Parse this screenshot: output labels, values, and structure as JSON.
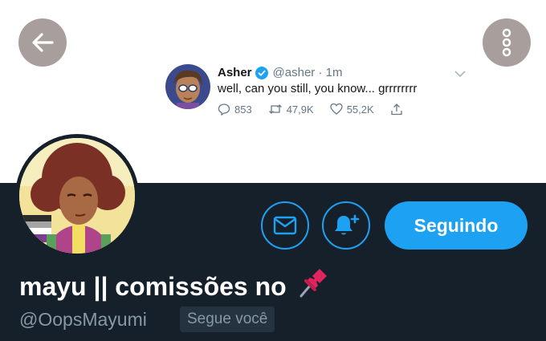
{
  "tweet": {
    "name": "Asher",
    "handle_time": "@asher · 1m",
    "text": "well, can you still, you know... grrrrrrrr",
    "replies": "853",
    "retweets": "47,9K",
    "likes": "55,2K"
  },
  "profile": {
    "display_name": "mayu || comissões no",
    "handle": "@OopsMayumi",
    "follows_you": "Segue você",
    "follow_button": "Seguindo"
  },
  "icons": {
    "back": "arrow-left-icon",
    "more": "vertical-dots-icon",
    "mail": "envelope-icon",
    "bell": "bell-plus-icon",
    "pin": "pushpin-icon",
    "verified": "verified-badge-icon"
  },
  "colors": {
    "accent": "#1da1f2",
    "dark_bg": "#15202b",
    "muted": "#8899a6",
    "badge_bg": "#253341",
    "overlay_button": "#a89f9c"
  }
}
